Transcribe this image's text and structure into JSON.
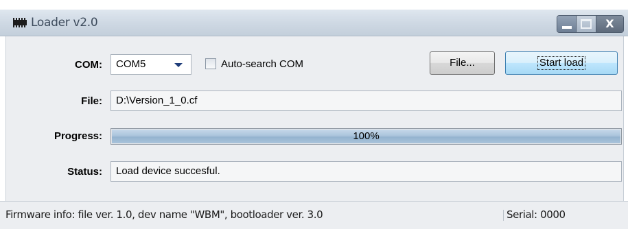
{
  "window": {
    "title": "Loader v2.0",
    "close_glyph": "X"
  },
  "form": {
    "com_label": "COM:",
    "com_value": "COM5",
    "autosearch_label": "Auto-search COM",
    "autosearch_checked": false,
    "file_button": "File...",
    "start_button": "Start load",
    "file_label": "File:",
    "file_value": "D:\\Version_1_0.cf",
    "progress_label": "Progress:",
    "progress_percent": 100,
    "progress_text": "100%",
    "status_label": "Status:",
    "status_value": "Load device succesful."
  },
  "statusbar": {
    "firmware_info": "Firmware info: file ver. 1.0, dev name \"WBM\", bootloader ver. 3.0",
    "serial": "Serial: 0000"
  },
  "colors": {
    "accent_button": "#bee6fd",
    "progress_fill": "#a9c3db",
    "titlebar": "#cfd9e4"
  }
}
